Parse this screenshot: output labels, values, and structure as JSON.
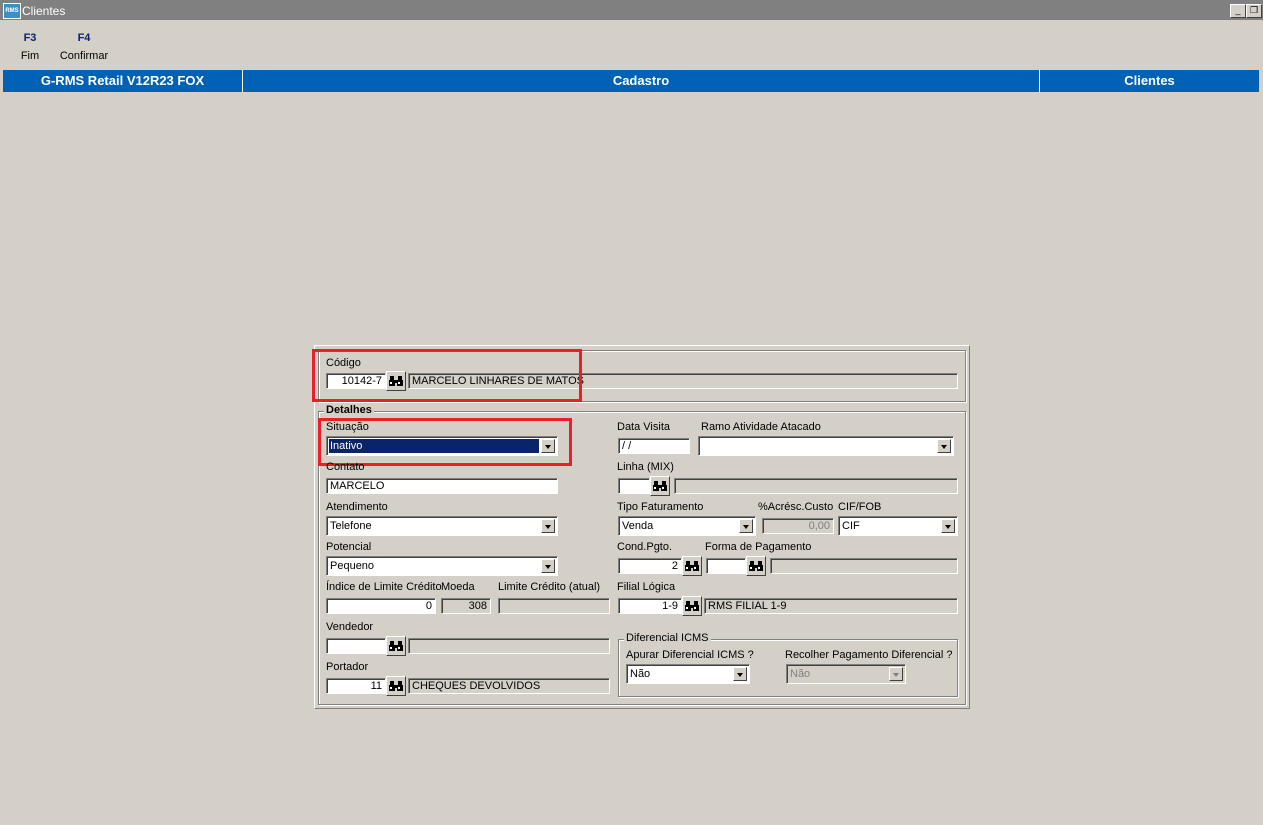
{
  "window": {
    "title": "Clientes",
    "icon": "rms-app-icon",
    "icon_text": "RMS"
  },
  "toolbar": [
    {
      "key": "F3",
      "label": "Fim"
    },
    {
      "key": "F4",
      "label": "Confirmar"
    }
  ],
  "header": {
    "left": "G-RMS Retail V12R23 FOX",
    "center": "Cadastro",
    "right": "Clientes"
  },
  "codigo": {
    "label": "Código",
    "value": "10142-7",
    "name": "MARCELO LINHARES DE MATOS"
  },
  "detalhes": {
    "legend": "Detalhes",
    "situacao": {
      "label": "Situação",
      "value": "Inativo"
    },
    "contato": {
      "label": "Contato",
      "value": "MARCELO"
    },
    "atendimento": {
      "label": "Atendimento",
      "value": "Telefone"
    },
    "potencial": {
      "label": "Potencial",
      "value": "Pequeno"
    },
    "indice_limite": {
      "label": "Índice de Limite Crédito",
      "value": "0"
    },
    "moeda": {
      "label": "Moeda",
      "value": "308"
    },
    "limite_atual": {
      "label": "Limite Crédito (atual)",
      "value": ""
    },
    "vendedor": {
      "label": "Vendedor",
      "value": "",
      "name": ""
    },
    "portador": {
      "label": "Portador",
      "value": "11",
      "name": "CHEQUES DEVOLVIDOS"
    },
    "data_visita": {
      "label": "Data Visita",
      "value": " /  /"
    },
    "ramo_atividade": {
      "label": "Ramo Atividade Atacado",
      "value": ""
    },
    "linha_mix": {
      "label": "Linha (MIX)",
      "value": "",
      "name": ""
    },
    "tipo_faturamento": {
      "label": "Tipo Faturamento",
      "value": "Venda"
    },
    "acresc_custo": {
      "label": "%Acrésc.Custo",
      "value": "0,00"
    },
    "cif_fob": {
      "label": "CIF/FOB",
      "value": "CIF"
    },
    "cond_pgto": {
      "label": "Cond.Pgto.",
      "value": "2"
    },
    "forma_pagamento": {
      "label": "Forma de Pagamento",
      "value": "",
      "name": ""
    },
    "filial_logica": {
      "label": "Filial Lógica",
      "value": "1-9",
      "name": "RMS FILIAL 1-9"
    },
    "diferencial_icms": {
      "legend": "Diferencial ICMS",
      "apurar": {
        "label": "Apurar Diferencial ICMS ?",
        "value": "Não"
      },
      "recolher": {
        "label": "Recolher Pagamento Diferencial ?",
        "value": "Não"
      }
    }
  },
  "colors": {
    "header_band": "#0061b5",
    "highlight_box": "#e8202a",
    "background": "#d4d0c8"
  }
}
